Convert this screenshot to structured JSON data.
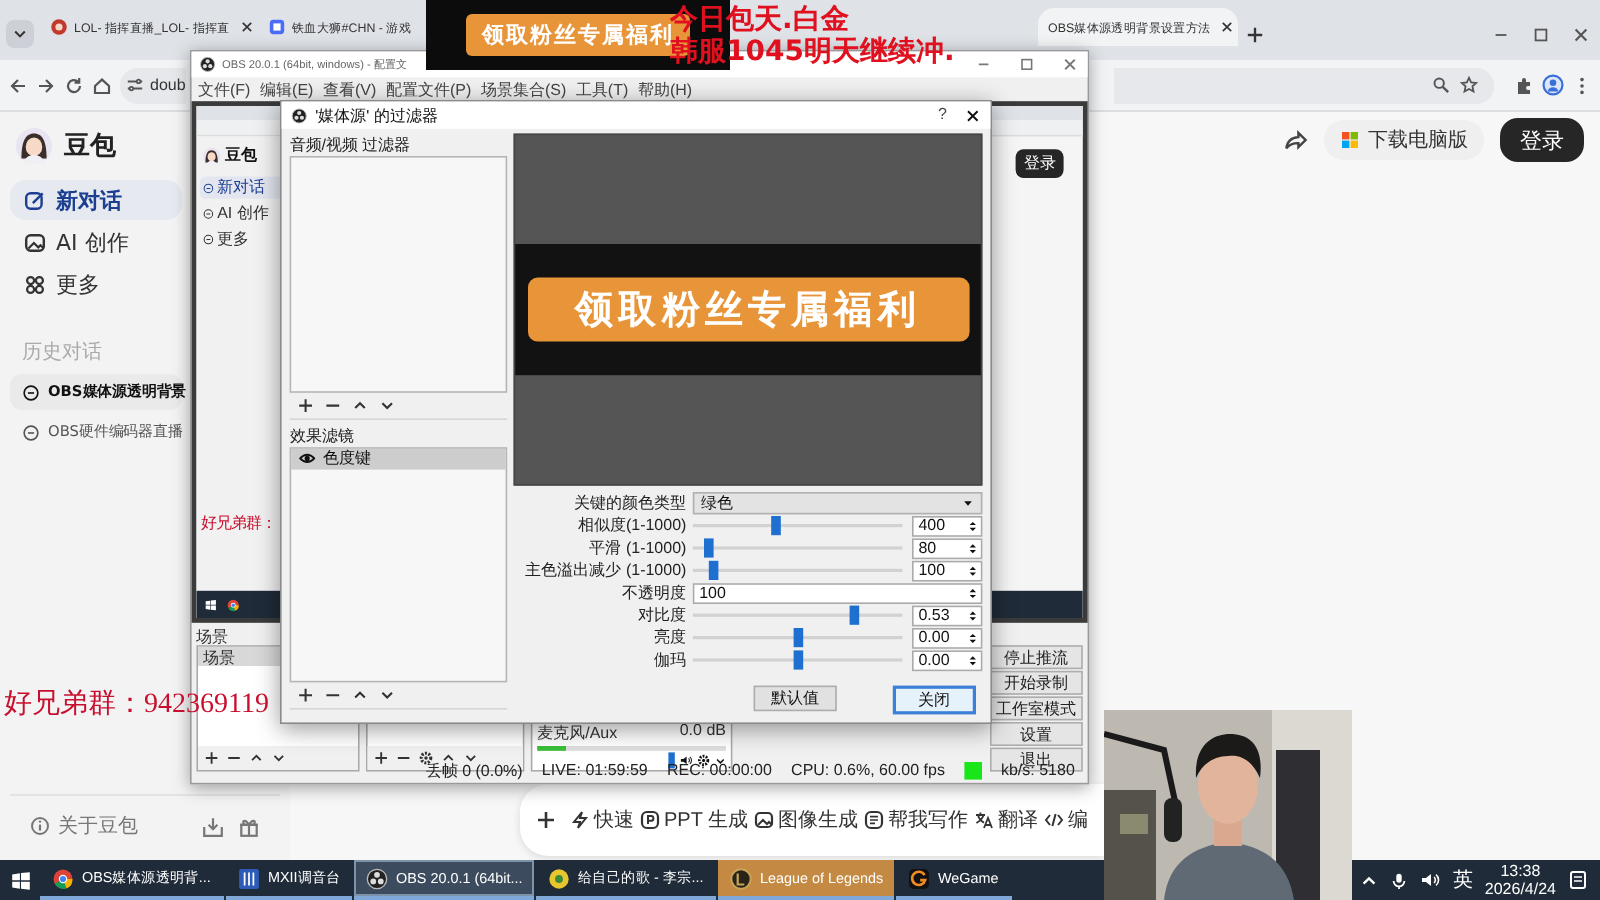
{
  "browser": {
    "tabs": [
      {
        "title": "LOL- 指挥直播_LOL- 指挥直",
        "selected": false
      },
      {
        "title": "铁血大狮#CHN - 游戏",
        "selected": false
      },
      {
        "title": "OBS媒体源透明背景设置方法",
        "selected": true
      }
    ],
    "address": "doub",
    "sidebar": {
      "app_name": "豆包",
      "nav": [
        {
          "label": "新对话",
          "selected": true
        },
        {
          "label": "AI 创作",
          "selected": false
        },
        {
          "label": "更多",
          "selected": false
        }
      ],
      "history_title": "历史对话",
      "history": [
        {
          "label": "OBS媒体源透明背景",
          "selected": true
        },
        {
          "label": "OBS硬件编码器直播",
          "selected": false
        }
      ],
      "about": "关于豆包"
    },
    "header": {
      "download": "下载电脑版",
      "login": "登录"
    },
    "toolbar": [
      {
        "label": "快速"
      },
      {
        "label": "PPT 生成"
      },
      {
        "label": "图像生成"
      },
      {
        "label": "帮我写作"
      },
      {
        "label": "翻译"
      },
      {
        "label": "编"
      }
    ]
  },
  "overlay": {
    "banner": "领取粉丝专属福利",
    "lines": [
      "今日包天.白金",
      "韩服1045明天继续冲."
    ],
    "group": "好兄弟群：942369119"
  },
  "obs": {
    "title": "OBS 20.0.1 (64bit, windows) - 配置文",
    "menu": [
      "文件(F)",
      "编辑(E)",
      "查看(V)",
      "配置文件(P)",
      "场景集合(S)",
      "工具(T)",
      "帮助(H)"
    ],
    "preview": {
      "app_name": "豆包",
      "nav": [
        {
          "label": "新对话",
          "selected": true
        },
        {
          "label": "AI 创作",
          "selected": false
        },
        {
          "label": "更多",
          "selected": false
        }
      ],
      "group": "好兄弟群：",
      "login": "登录"
    },
    "scenes_title": "场景",
    "scenes_header": "场景",
    "mixer": {
      "name": "麦克风/Aux",
      "reading": "0.0 dB",
      "level": 0.15
    },
    "controls": [
      "停止推流",
      "开始录制",
      "工作室模式",
      "设置",
      "退出"
    ],
    "status": [
      "丢帧 0 (0.0%)",
      "LIVE: 01:59:59",
      "REC: 00:00:00",
      "CPU: 0.6%, 60.00 fps",
      "kb/s: 5180"
    ]
  },
  "dialog": {
    "title": "'媒体源' 的过滤器",
    "help": "?",
    "av_title": "音频/视频 过滤器",
    "effects_title": "效果滤镜",
    "effects": [
      {
        "label": "色度键",
        "selected": true,
        "visible": true
      }
    ],
    "preview_banner": "领取粉丝专属福利",
    "properties": [
      {
        "kind": "select",
        "label": "关键的颜色类型",
        "value": "绿色"
      },
      {
        "kind": "slider",
        "label": "相似度(1-1000)",
        "level": 0.4,
        "value": "400"
      },
      {
        "kind": "slider",
        "label": "平滑 (1-1000)",
        "level": 0.08,
        "value": "80"
      },
      {
        "kind": "slider",
        "label": "主色溢出减少 (1-1000)",
        "level": 0.1,
        "value": "100"
      },
      {
        "kind": "number",
        "label": "不透明度",
        "value": "100"
      },
      {
        "kind": "slider",
        "label": "对比度",
        "level": 0.77,
        "value": "0.53"
      },
      {
        "kind": "slider",
        "label": "亮度",
        "level": 0.5,
        "value": "0.00"
      },
      {
        "kind": "slider",
        "label": "伽玛",
        "level": 0.5,
        "value": "0.00"
      }
    ],
    "buttons": [
      {
        "label": "默认值",
        "default": false
      },
      {
        "label": "关闭",
        "default": true
      }
    ]
  },
  "taskbar": {
    "items": [
      {
        "label": "OBS媒体源透明背...",
        "selected": false,
        "flashing": false
      },
      {
        "label": "MXII调音台",
        "selected": false,
        "flashing": false
      },
      {
        "label": "OBS 20.0.1 (64bit...",
        "selected": true,
        "flashing": false
      },
      {
        "label": "给自己的歌 - 李宗...",
        "selected": false,
        "flashing": false
      },
      {
        "label": "League of Legends",
        "selected": false,
        "flashing": true
      },
      {
        "label": "WeGame",
        "selected": false,
        "flashing": false
      }
    ],
    "ime": "英",
    "time": "13:38",
    "date": "2026/4/24"
  }
}
